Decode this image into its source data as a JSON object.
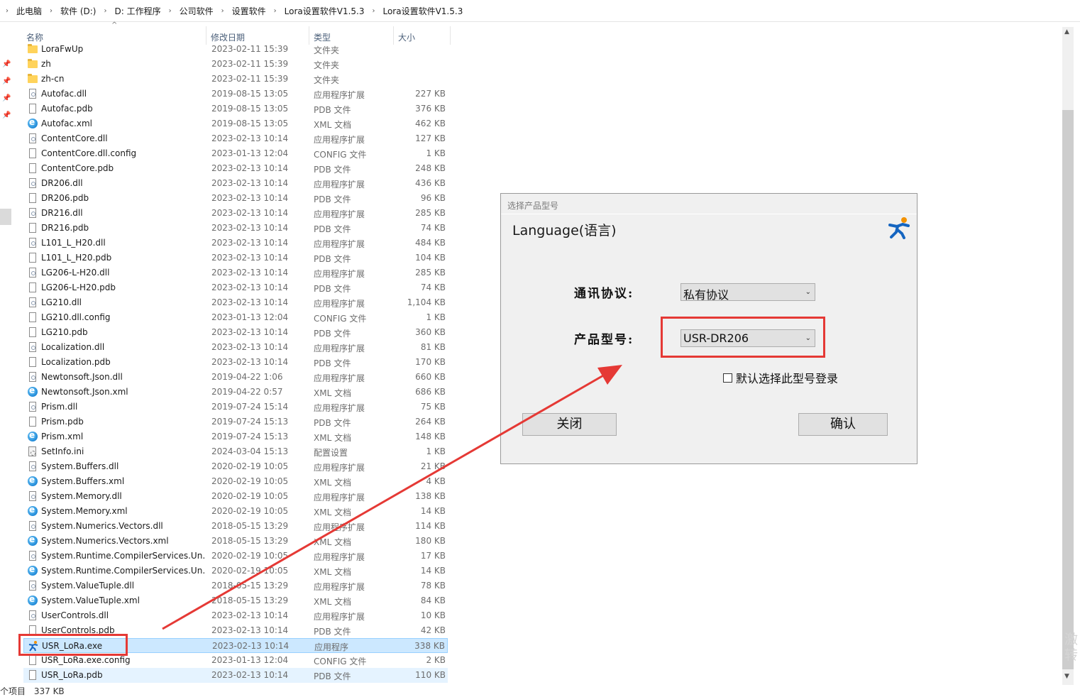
{
  "breadcrumb": [
    "此电脑",
    "软件 (D:)",
    "D: 工作程序",
    "公司软件",
    "设置软件",
    "Lora设置软件V1.5.3",
    "Lora设置软件V1.5.3"
  ],
  "columns": {
    "name": "名称",
    "date": "修改日期",
    "type": "类型",
    "size": "大小"
  },
  "files": [
    {
      "name": "LoraFwUp",
      "date": "2023-02-11 15:39",
      "type": "文件夹",
      "size": "",
      "icon": "folder"
    },
    {
      "name": "zh",
      "date": "2023-02-11 15:39",
      "type": "文件夹",
      "size": "",
      "icon": "folder"
    },
    {
      "name": "zh-cn",
      "date": "2023-02-11 15:39",
      "type": "文件夹",
      "size": "",
      "icon": "folder"
    },
    {
      "name": "Autofac.dll",
      "date": "2019-08-15 13:05",
      "type": "应用程序扩展",
      "size": "227 KB",
      "icon": "dll"
    },
    {
      "name": "Autofac.pdb",
      "date": "2019-08-15 13:05",
      "type": "PDB 文件",
      "size": "376 KB",
      "icon": "file"
    },
    {
      "name": "Autofac.xml",
      "date": "2019-08-15 13:05",
      "type": "XML 文档",
      "size": "462 KB",
      "icon": "xml"
    },
    {
      "name": "ContentCore.dll",
      "date": "2023-02-13 10:14",
      "type": "应用程序扩展",
      "size": "127 KB",
      "icon": "dll"
    },
    {
      "name": "ContentCore.dll.config",
      "date": "2023-01-13 12:04",
      "type": "CONFIG 文件",
      "size": "1 KB",
      "icon": "file"
    },
    {
      "name": "ContentCore.pdb",
      "date": "2023-02-13 10:14",
      "type": "PDB 文件",
      "size": "248 KB",
      "icon": "file"
    },
    {
      "name": "DR206.dll",
      "date": "2023-02-13 10:14",
      "type": "应用程序扩展",
      "size": "436 KB",
      "icon": "dll"
    },
    {
      "name": "DR206.pdb",
      "date": "2023-02-13 10:14",
      "type": "PDB 文件",
      "size": "96 KB",
      "icon": "file"
    },
    {
      "name": "DR216.dll",
      "date": "2023-02-13 10:14",
      "type": "应用程序扩展",
      "size": "285 KB",
      "icon": "dll"
    },
    {
      "name": "DR216.pdb",
      "date": "2023-02-13 10:14",
      "type": "PDB 文件",
      "size": "74 KB",
      "icon": "file"
    },
    {
      "name": "L101_L_H20.dll",
      "date": "2023-02-13 10:14",
      "type": "应用程序扩展",
      "size": "484 KB",
      "icon": "dll"
    },
    {
      "name": "L101_L_H20.pdb",
      "date": "2023-02-13 10:14",
      "type": "PDB 文件",
      "size": "104 KB",
      "icon": "file"
    },
    {
      "name": "LG206-L-H20.dll",
      "date": "2023-02-13 10:14",
      "type": "应用程序扩展",
      "size": "285 KB",
      "icon": "dll"
    },
    {
      "name": "LG206-L-H20.pdb",
      "date": "2023-02-13 10:14",
      "type": "PDB 文件",
      "size": "74 KB",
      "icon": "file"
    },
    {
      "name": "LG210.dll",
      "date": "2023-02-13 10:14",
      "type": "应用程序扩展",
      "size": "1,104 KB",
      "icon": "dll"
    },
    {
      "name": "LG210.dll.config",
      "date": "2023-01-13 12:04",
      "type": "CONFIG 文件",
      "size": "1 KB",
      "icon": "file"
    },
    {
      "name": "LG210.pdb",
      "date": "2023-02-13 10:14",
      "type": "PDB 文件",
      "size": "360 KB",
      "icon": "file"
    },
    {
      "name": "Localization.dll",
      "date": "2023-02-13 10:14",
      "type": "应用程序扩展",
      "size": "81 KB",
      "icon": "dll"
    },
    {
      "name": "Localization.pdb",
      "date": "2023-02-13 10:14",
      "type": "PDB 文件",
      "size": "170 KB",
      "icon": "file"
    },
    {
      "name": "Newtonsoft.Json.dll",
      "date": "2019-04-22 1:06",
      "type": "应用程序扩展",
      "size": "660 KB",
      "icon": "dll"
    },
    {
      "name": "Newtonsoft.Json.xml",
      "date": "2019-04-22 0:57",
      "type": "XML 文档",
      "size": "686 KB",
      "icon": "xml"
    },
    {
      "name": "Prism.dll",
      "date": "2019-07-24 15:14",
      "type": "应用程序扩展",
      "size": "75 KB",
      "icon": "dll"
    },
    {
      "name": "Prism.pdb",
      "date": "2019-07-24 15:13",
      "type": "PDB 文件",
      "size": "264 KB",
      "icon": "file"
    },
    {
      "name": "Prism.xml",
      "date": "2019-07-24 15:13",
      "type": "XML 文档",
      "size": "148 KB",
      "icon": "xml"
    },
    {
      "name": "SetInfo.ini",
      "date": "2024-03-04 15:13",
      "type": "配置设置",
      "size": "1 KB",
      "icon": "ini"
    },
    {
      "name": "System.Buffers.dll",
      "date": "2020-02-19 10:05",
      "type": "应用程序扩展",
      "size": "21 KB",
      "icon": "dll"
    },
    {
      "name": "System.Buffers.xml",
      "date": "2020-02-19 10:05",
      "type": "XML 文档",
      "size": "4 KB",
      "icon": "xml"
    },
    {
      "name": "System.Memory.dll",
      "date": "2020-02-19 10:05",
      "type": "应用程序扩展",
      "size": "138 KB",
      "icon": "dll"
    },
    {
      "name": "System.Memory.xml",
      "date": "2020-02-19 10:05",
      "type": "XML 文档",
      "size": "14 KB",
      "icon": "xml"
    },
    {
      "name": "System.Numerics.Vectors.dll",
      "date": "2018-05-15 13:29",
      "type": "应用程序扩展",
      "size": "114 KB",
      "icon": "dll"
    },
    {
      "name": "System.Numerics.Vectors.xml",
      "date": "2018-05-15 13:29",
      "type": "XML 文档",
      "size": "180 KB",
      "icon": "xml"
    },
    {
      "name": "System.Runtime.CompilerServices.Un...",
      "date": "2020-02-19 10:05",
      "type": "应用程序扩展",
      "size": "17 KB",
      "icon": "dll"
    },
    {
      "name": "System.Runtime.CompilerServices.Un...",
      "date": "2020-02-19 10:05",
      "type": "XML 文档",
      "size": "14 KB",
      "icon": "xml"
    },
    {
      "name": "System.ValueTuple.dll",
      "date": "2018-05-15 13:29",
      "type": "应用程序扩展",
      "size": "78 KB",
      "icon": "dll"
    },
    {
      "name": "System.ValueTuple.xml",
      "date": "2018-05-15 13:29",
      "type": "XML 文档",
      "size": "84 KB",
      "icon": "xml"
    },
    {
      "name": "UserControls.dll",
      "date": "2023-02-13 10:14",
      "type": "应用程序扩展",
      "size": "10 KB",
      "icon": "dll"
    },
    {
      "name": "UserControls.pdb",
      "date": "2023-02-13 10:14",
      "type": "PDB 文件",
      "size": "42 KB",
      "icon": "file"
    },
    {
      "name": "USR_LoRa.exe",
      "date": "2023-02-13 10:14",
      "type": "应用程序",
      "size": "338 KB",
      "icon": "exe",
      "selected": true
    },
    {
      "name": "USR_LoRa.exe.config",
      "date": "2023-01-13 12:04",
      "type": "CONFIG 文件",
      "size": "2 KB",
      "icon": "file"
    },
    {
      "name": "USR_LoRa.pdb",
      "date": "2023-02-13 10:14",
      "type": "PDB 文件",
      "size": "110 KB",
      "icon": "file",
      "hover": true
    }
  ],
  "status": {
    "count": "个项目",
    "size": "337 KB"
  },
  "watermark": [
    "激",
    "转"
  ],
  "dialog": {
    "title": "选择产品型号",
    "language_label": "Language(语言)",
    "protocol_label": "通讯协议:",
    "protocol_value": "私有协议",
    "model_label": "产品型号:",
    "model_value": "USR-DR206",
    "remember_label": "默认选择此型号登录",
    "remember_checked": false,
    "close_button": "关闭",
    "ok_button": "确认"
  },
  "annotation_color": "#e53935"
}
